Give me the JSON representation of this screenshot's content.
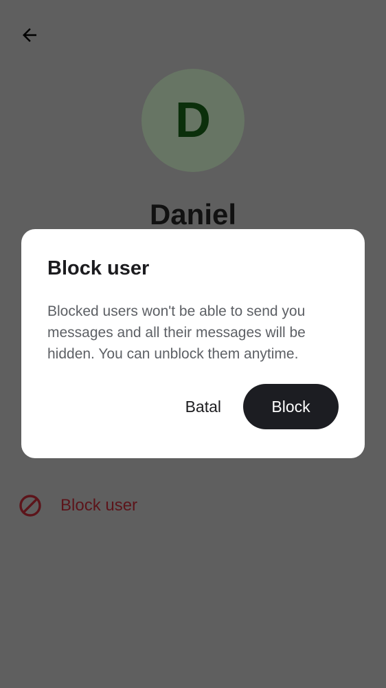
{
  "header": {
    "back_icon": "arrow-left-icon"
  },
  "profile": {
    "avatar_letter": "D",
    "name": "Daniel"
  },
  "actions": {
    "block_user_label": "Block user",
    "block_icon": "block-icon"
  },
  "dialog": {
    "title": "Block user",
    "message": "Blocked users won't be able to send you messages and all their messages will be hidden. You can unblock them anytime.",
    "cancel_label": "Batal",
    "confirm_label": "Block"
  },
  "colors": {
    "scrim": "#5f5f5f",
    "avatar_bg": "#677564",
    "avatar_text": "#0b2f0b",
    "danger": "#5c141a",
    "dialog_bg": "#ffffff",
    "primary_button": "#1c1d22"
  }
}
